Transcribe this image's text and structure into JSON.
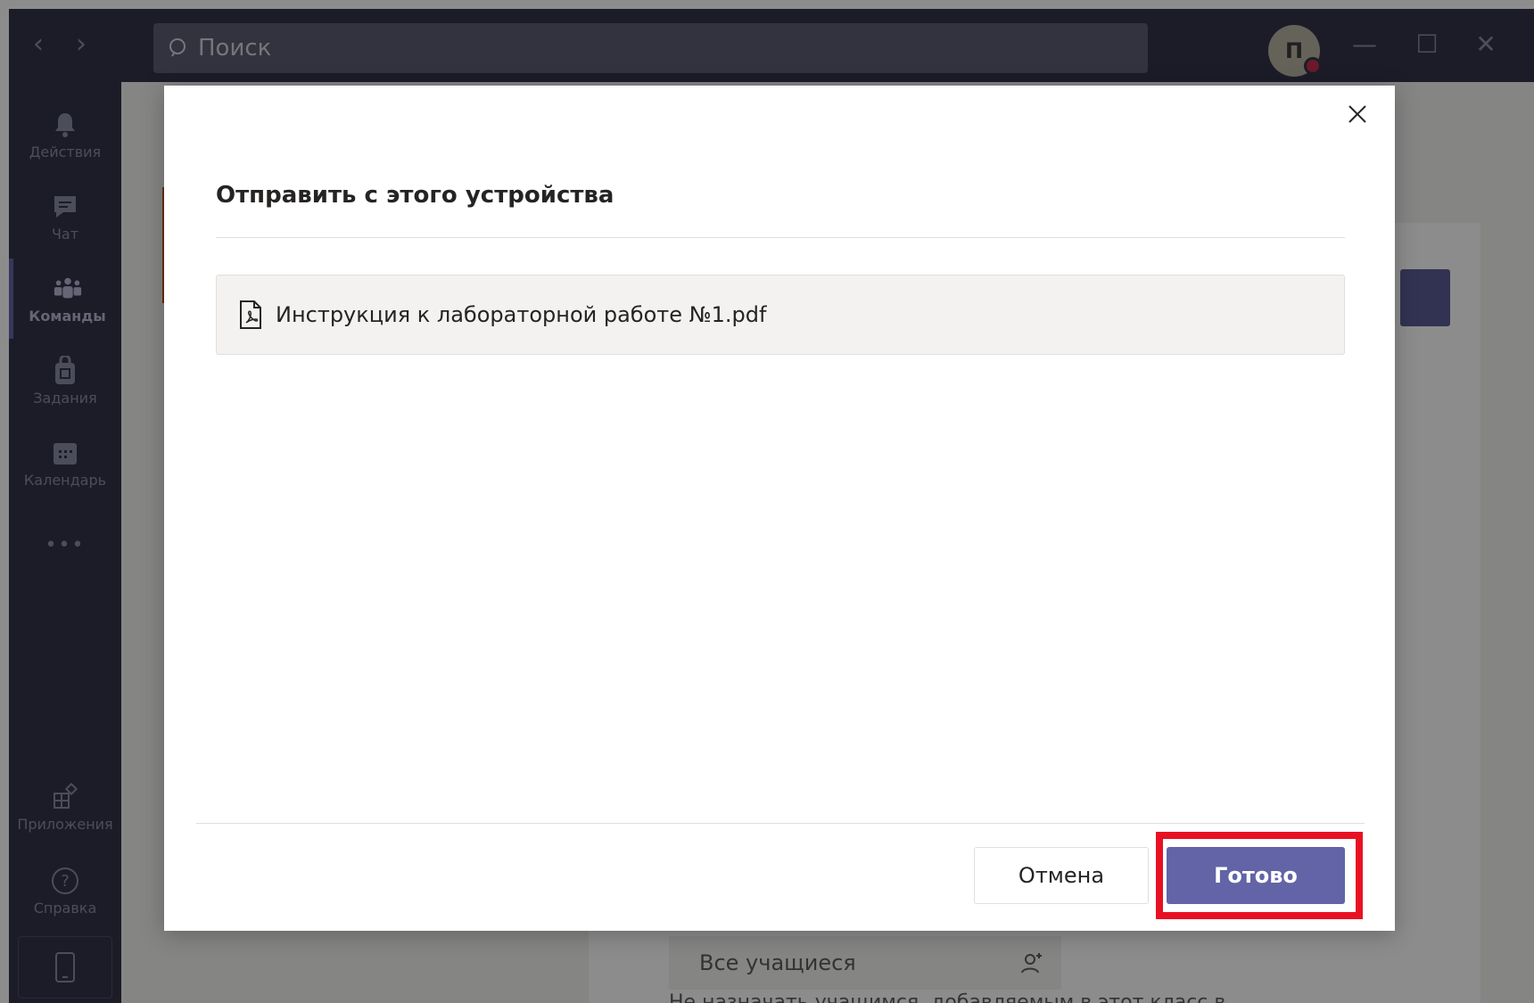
{
  "search": {
    "placeholder": "Поиск"
  },
  "user": {
    "initial": "П"
  },
  "rail": {
    "items": [
      {
        "label": "Действия",
        "icon": "bell-icon"
      },
      {
        "label": "Чат",
        "icon": "chat-icon"
      },
      {
        "label": "Команды",
        "icon": "teams-icon"
      },
      {
        "label": "Задания",
        "icon": "assignments-icon"
      },
      {
        "label": "Календарь",
        "icon": "calendar-icon"
      },
      {
        "label": "•••",
        "icon": "more-icon"
      },
      {
        "label": "Приложения",
        "icon": "apps-icon"
      },
      {
        "label": "Справка",
        "icon": "help-icon"
      }
    ]
  },
  "background": {
    "assign_label": "Все учащиеся",
    "description": "Не назначать учащимся, добавляемым в этот класс в"
  },
  "dialog": {
    "title": "Отправить с этого устройства",
    "file_name": "Инструкция к лабораторной работе №1.pdf",
    "cancel_label": "Отмена",
    "done_label": "Готово"
  },
  "colors": {
    "accent": "#6264a7",
    "highlight": "#e81123",
    "titlebar": "#33344a"
  }
}
